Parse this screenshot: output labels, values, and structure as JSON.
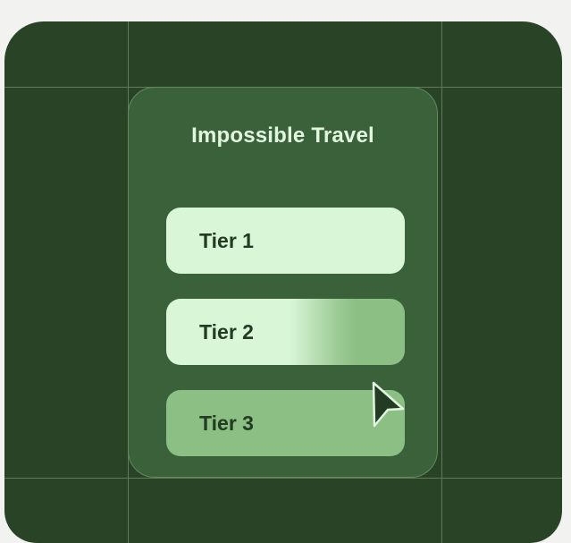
{
  "panel": {
    "title": "Impossible Travel",
    "tiers": [
      {
        "label": "Tier 1"
      },
      {
        "label": "Tier 2"
      },
      {
        "label": "Tier 3"
      }
    ]
  },
  "colors": {
    "background": "#294326",
    "panel": "#3a613a",
    "tier_light": "#d9f6d7",
    "tier_selected": "#8bbf83",
    "text_dark": "#233b22",
    "title_text": "#e2f6df"
  },
  "icons": {
    "pointer": "cursor-arrow-icon"
  }
}
